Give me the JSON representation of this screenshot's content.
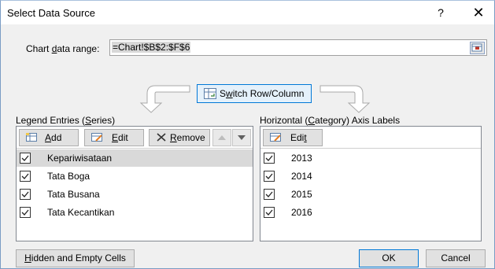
{
  "window": {
    "title": "Select Data Source",
    "help_glyph": "?",
    "close_glyph": "✕"
  },
  "chart_range": {
    "label_pre": "Chart ",
    "label_u": "d",
    "label_post": "ata range:",
    "value": "=Chart!$B$2:$F$6"
  },
  "switch": {
    "label_pre": "S",
    "label_u": "w",
    "label_post": "itch Row/Column"
  },
  "legend": {
    "title_pre": "Legend Entries (",
    "title_u": "S",
    "title_post": "eries)",
    "add_u": "A",
    "add_rest": "dd",
    "edit_u": "E",
    "edit_rest": "dit",
    "remove_u": "R",
    "remove_rest": "emove",
    "items": [
      {
        "label": "Kepariwisataan",
        "checked": true,
        "selected": true
      },
      {
        "label": "Tata Boga",
        "checked": true,
        "selected": false
      },
      {
        "label": "Tata Busana",
        "checked": true,
        "selected": false
      },
      {
        "label": "Tata Kecantikan",
        "checked": true,
        "selected": false
      }
    ]
  },
  "axis": {
    "title_pre": "Horizontal (",
    "title_u": "C",
    "title_post": "ategory) Axis Labels",
    "edit_pre": "Edi",
    "edit_u": "t",
    "items": [
      {
        "label": "2013",
        "checked": true
      },
      {
        "label": "2014",
        "checked": true
      },
      {
        "label": "2015",
        "checked": true
      },
      {
        "label": "2016",
        "checked": true
      }
    ]
  },
  "footer": {
    "hidden_u": "H",
    "hidden_rest": "idden and Empty Cells",
    "ok": "OK",
    "cancel": "Cancel"
  },
  "colors": {
    "accent": "#0078d7",
    "selection": "#d9d9d9",
    "dialog_bg": "#f0f0f0"
  }
}
